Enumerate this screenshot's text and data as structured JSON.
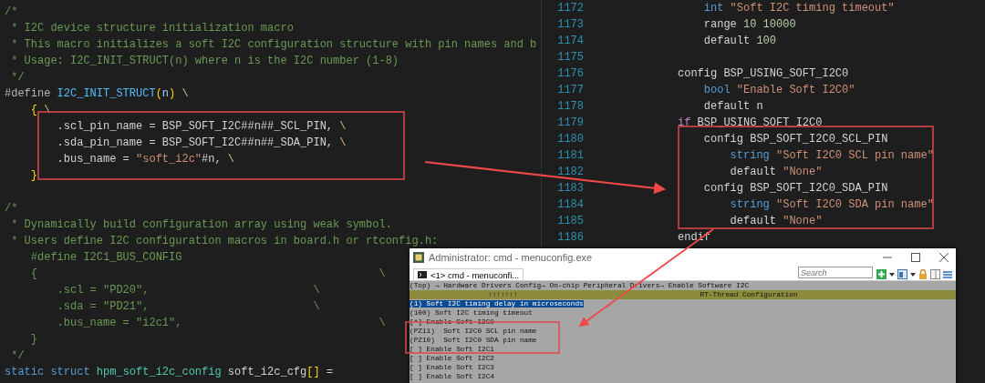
{
  "left_editor": {
    "blocks": [
      {
        "lines": [
          {
            "tokens": [
              {
                "kind": "comment",
                "text": "/*"
              }
            ]
          },
          {
            "tokens": [
              {
                "kind": "comment",
                "text": " * I2C device structure initialization macro"
              }
            ]
          },
          {
            "tokens": [
              {
                "kind": "comment",
                "text": " * This macro initializes a soft I2C configuration structure with pin names and b"
              }
            ]
          },
          {
            "tokens": [
              {
                "kind": "comment",
                "text": " * Usage: I2C_INIT_STRUCT(n) where n is the I2C number (1-8)"
              }
            ]
          },
          {
            "tokens": [
              {
                "kind": "comment",
                "text": " */"
              }
            ]
          },
          {
            "tokens": [
              {
                "kind": "directive",
                "text": "#define "
              },
              {
                "kind": "macro",
                "text": "I2C_INIT_STRUCT"
              },
              {
                "kind": "bracket",
                "text": "("
              },
              {
                "kind": "param",
                "text": "n"
              },
              {
                "kind": "bracket",
                "text": ")"
              },
              {
                "kind": "escape",
                "text": " \\"
              }
            ]
          },
          {
            "tokens": [
              {
                "kind": "bracket",
                "text": "    {"
              },
              {
                "kind": "escape",
                "text": " \\"
              }
            ]
          },
          {
            "tokens": [
              {
                "kind": "plain",
                "text": "        .scl_pin_name = BSP_SOFT_I2C##n##_SCL_PIN, "
              },
              {
                "kind": "escape",
                "text": "\\"
              }
            ]
          },
          {
            "tokens": [
              {
                "kind": "plain",
                "text": "        .sda_pin_name = BSP_SOFT_I2C##n##_SDA_PIN, "
              },
              {
                "kind": "escape",
                "text": "\\"
              }
            ]
          },
          {
            "tokens": [
              {
                "kind": "plain",
                "text": "        .bus_name = "
              },
              {
                "kind": "string",
                "text": "\"soft_i2c\""
              },
              {
                "kind": "plain",
                "text": "#n, "
              },
              {
                "kind": "escape",
                "text": "\\"
              }
            ]
          },
          {
            "tokens": [
              {
                "kind": "bracket",
                "text": "    }"
              }
            ]
          }
        ]
      },
      {
        "lines": [
          {
            "tokens": [
              {
                "kind": "comment",
                "text": "/*"
              }
            ]
          },
          {
            "tokens": [
              {
                "kind": "comment",
                "text": " * Dynamically build configuration array using weak symbol."
              }
            ]
          },
          {
            "tokens": [
              {
                "kind": "comment",
                "text": " * Users define I2C configuration macros in board.h or rtconfig.h:"
              }
            ]
          },
          {
            "tokens": [
              {
                "kind": "comment",
                "text": "    #define I2C1_BUS_CONFIG"
              }
            ]
          },
          {
            "tokens": [
              {
                "kind": "comment",
                "text": "    {                                                    \\"
              }
            ]
          },
          {
            "tokens": [
              {
                "kind": "comment",
                "text": "        .scl = \"PD20\",                         \\"
              }
            ]
          },
          {
            "tokens": [
              {
                "kind": "comment",
                "text": "        .sda = \"PD21\",                         \\"
              }
            ]
          },
          {
            "tokens": [
              {
                "kind": "comment",
                "text": "        .bus_name = \"i2c1\",                              \\"
              }
            ]
          },
          {
            "tokens": [
              {
                "kind": "comment",
                "text": "    }"
              }
            ]
          },
          {
            "tokens": [
              {
                "kind": "comment",
                "text": " */"
              }
            ]
          },
          {
            "tokens": [
              {
                "kind": "keyword",
                "text": "static struct "
              },
              {
                "kind": "type",
                "text": "hpm_soft_i2c_config"
              },
              {
                "kind": "plain",
                "text": " soft_i2c_cfg"
              },
              {
                "kind": "bracket",
                "text": "[]"
              },
              {
                "kind": "plain",
                "text": " ="
              }
            ]
          }
        ]
      }
    ]
  },
  "right_editor": {
    "lines": [
      {
        "number": "1172",
        "tokens": [
          {
            "kind": "keyword",
            "text": "    int "
          },
          {
            "kind": "string",
            "text": "\"Soft I2C timing timeout\""
          }
        ]
      },
      {
        "number": "1173",
        "tokens": [
          {
            "kind": "plain",
            "text": "    range "
          },
          {
            "kind": "number",
            "text": "10 10000"
          }
        ]
      },
      {
        "number": "1174",
        "tokens": [
          {
            "kind": "plain",
            "text": "    default "
          },
          {
            "kind": "number",
            "text": "100"
          }
        ]
      },
      {
        "number": "1175"
      },
      {
        "number": "1176",
        "tokens": [
          {
            "kind": "plain",
            "text": "config BSP_USING_SOFT_I2C0"
          }
        ]
      },
      {
        "number": "1177",
        "tokens": [
          {
            "kind": "keyword",
            "text": "    bool "
          },
          {
            "kind": "string",
            "text": "\"Enable Soft I2C0\""
          }
        ]
      },
      {
        "number": "1178",
        "tokens": [
          {
            "kind": "plain",
            "text": "    default n"
          }
        ]
      },
      {
        "number": "1179",
        "tokens": [
          {
            "kind": "control",
            "text": "if"
          },
          {
            "kind": "plain",
            "text": " BSP_USING_SOFT_I2C0"
          }
        ]
      },
      {
        "number": "1180",
        "tokens": [
          {
            "kind": "plain",
            "text": "    config BSP_SOFT_I2C0_SCL_PIN"
          }
        ]
      },
      {
        "number": "1181",
        "tokens": [
          {
            "kind": "keyword",
            "text": "        string "
          },
          {
            "kind": "string",
            "text": "\"Soft I2C0 SCL pin name\""
          }
        ]
      },
      {
        "number": "1182",
        "tokens": [
          {
            "kind": "plain",
            "text": "        default "
          },
          {
            "kind": "string",
            "text": "\"None\""
          }
        ]
      },
      {
        "number": "1183",
        "tokens": [
          {
            "kind": "plain",
            "text": "    config BSP_SOFT_I2C0_SDA_PIN"
          }
        ]
      },
      {
        "number": "1184",
        "tokens": [
          {
            "kind": "keyword",
            "text": "        string "
          },
          {
            "kind": "string",
            "text": "\"Soft I2C0 SDA pin name\""
          }
        ]
      },
      {
        "number": "1185",
        "tokens": [
          {
            "kind": "plain",
            "text": "        default "
          },
          {
            "kind": "string",
            "text": "\"None\""
          }
        ]
      },
      {
        "number": "1186",
        "tokens": [
          {
            "kind": "plain",
            "text": "endif"
          }
        ]
      }
    ]
  },
  "terminal_window": {
    "title": "Administrator: cmd - menuconfig.exe",
    "tab": "<1> cmd - menuconfi...",
    "search": {
      "placeholder": "Search"
    },
    "breadcrumb": "(Top) → Hardware Drivers Config→ On-chip Peripheral Drivers→ Enable Software I2C",
    "header": {
      "marks": "↑↑↑↑↑↑↑",
      "title": "RT-Thread Configuration"
    },
    "items": [
      {
        "text": "(1) Soft I2C timing delay in microseconds",
        "selected": true
      },
      {
        "text": "(100) Soft I2C timing timeout",
        "selected": false
      },
      {
        "text": "[*] Enable Soft I2C0",
        "selected": false
      },
      {
        "text": "(PZ11)  Soft I2C0 SCL pin name",
        "selected": false
      },
      {
        "text": "(PZ10)  Soft I2C0 SDA pin name",
        "selected": false
      },
      {
        "text": "[ ] Enable Soft I2C1",
        "selected": false
      },
      {
        "text": "[ ] Enable Soft I2C2",
        "selected": false
      },
      {
        "text": "[ ] Enable Soft I2C3",
        "selected": false
      },
      {
        "text": "[ ] Enable Soft I2C4",
        "selected": false
      }
    ]
  }
}
